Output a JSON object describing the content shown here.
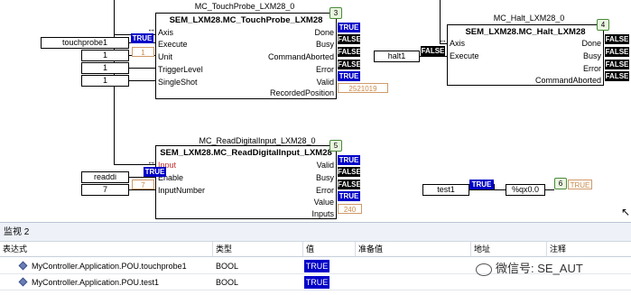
{
  "diagram": {
    "touchprobe": {
      "instance": "MC_TouchProbe_LXM28_0",
      "type": "SEM_LXM28.MC_TouchProbe_LXM28",
      "number": "3",
      "inputs": [
        "Axis",
        "Execute",
        "Unit",
        "TriggerLevel",
        "SingleShot"
      ],
      "outputs": [
        "Done",
        "Busy",
        "CommandAborted",
        "Error",
        "Valid",
        "RecordedPosition"
      ],
      "output_values": [
        "TRUE",
        "FALSE",
        "FALSE",
        "FALSE",
        "TRUE"
      ],
      "recorded_position": "2521019",
      "execute_var": "touchprobe1",
      "execute_value": "TRUE",
      "unit_value": "1",
      "unit_tag": "1",
      "trigger_value": "1",
      "singleshot_value": "1"
    },
    "halt": {
      "instance": "MC_Halt_LXM28_0",
      "type": "SEM_LXM28.MC_Halt_LXM28",
      "number": "4",
      "inputs": [
        "Axis",
        "Execute"
      ],
      "outputs": [
        "Done",
        "Busy",
        "Error",
        "CommandAborted"
      ],
      "output_values": [
        "FALSE",
        "FALSE",
        "FALSE",
        "FALSE"
      ],
      "execute_var": "halt1",
      "execute_value": "FALSE"
    },
    "readdi": {
      "instance": "MC_ReadDigitalInput_LXM28_0",
      "type": "SEM_LXM28.MC_ReadDigitalInput_LXM28",
      "number": "5",
      "inputs": [
        "Input",
        "Enable",
        "InputNumber"
      ],
      "outputs": [
        "Valid",
        "Busy",
        "Error",
        "Value",
        "Inputs"
      ],
      "output_values": [
        "TRUE",
        "FALSE",
        "FALSE",
        "TRUE"
      ],
      "inputs_value": "240",
      "enable_var": "readdi",
      "enable_value": "TRUE",
      "inputnumber_value": "7",
      "inputnumber_tag": "7"
    },
    "assign": {
      "source_var": "test1",
      "source_value": "TRUE",
      "target_var": "%qx0.0",
      "number": "6",
      "target_value": "TRUE"
    },
    "arrow_glyph": "↔"
  },
  "watch": {
    "title": "监视 2",
    "columns": [
      "表达式",
      "类型",
      "值",
      "准备值",
      "地址",
      "注释"
    ],
    "rows": [
      {
        "expression": "MyController.Application.POU.touchprobe1",
        "type": "BOOL",
        "value": "TRUE"
      },
      {
        "expression": "MyController.Application.POU.test1",
        "type": "BOOL",
        "value": "TRUE"
      }
    ]
  },
  "watermark": "微信号: SE_AUT",
  "colors": {
    "true_bg": "#0000c8",
    "false_bg": "#000000",
    "value_text": "#c98a4a"
  }
}
